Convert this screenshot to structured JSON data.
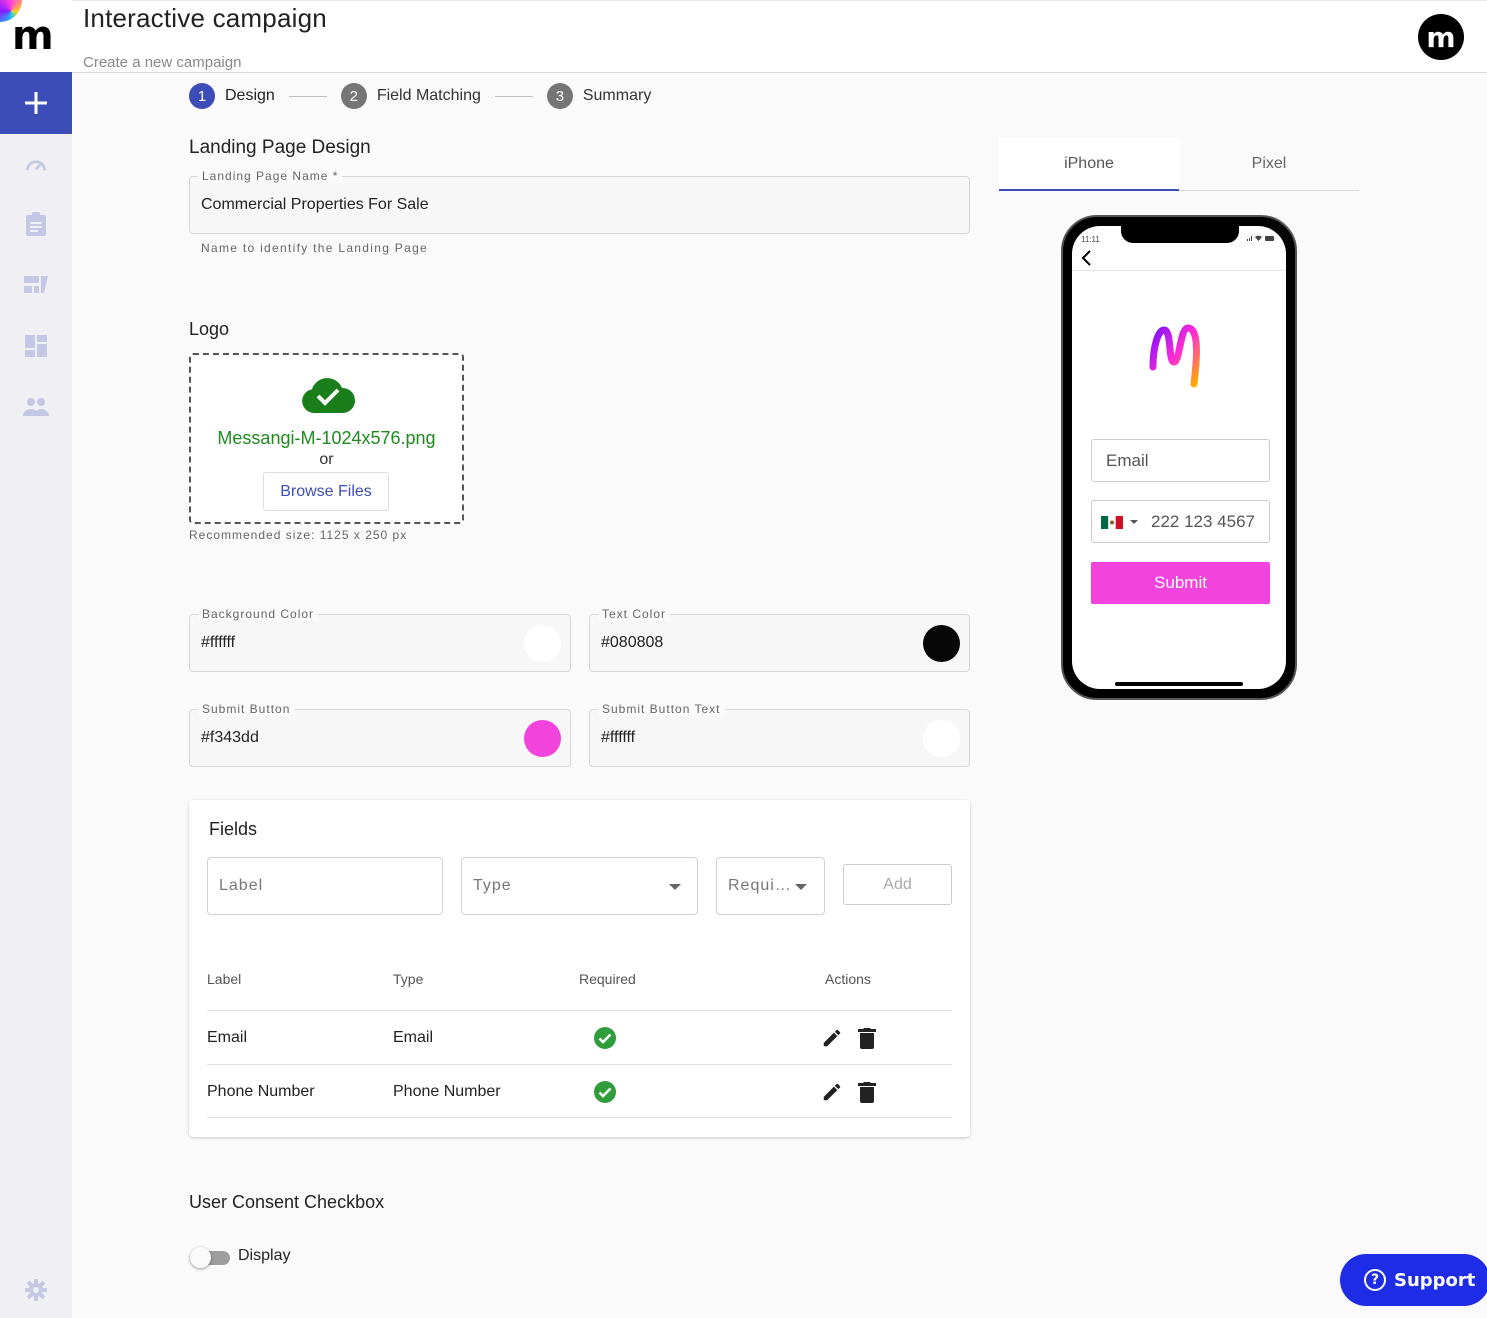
{
  "app": {
    "logo_letter": "m",
    "avatar_letter": "m"
  },
  "header": {
    "title": "Interactive campaign",
    "subtitle": "Create a new campaign"
  },
  "sidebar": {
    "items": [
      {
        "icon": "add-icon"
      },
      {
        "icon": "dashboard-gauge-icon"
      },
      {
        "icon": "clipboard-icon"
      },
      {
        "icon": "campaign-cards-icon"
      },
      {
        "icon": "grid-layout-icon"
      },
      {
        "icon": "people-icon"
      },
      {
        "icon": "gear-icon"
      }
    ]
  },
  "stepper": {
    "steps": [
      {
        "num": "1",
        "label": "Design",
        "active": true
      },
      {
        "num": "2",
        "label": "Field Matching"
      },
      {
        "num": "3",
        "label": "Summary"
      }
    ]
  },
  "landing": {
    "section_title": "Landing Page Design",
    "name_label": "Landing Page Name *",
    "name_value": "Commercial Properties For Sale",
    "name_helper": "Name to identify the Landing Page"
  },
  "logo": {
    "section_title": "Logo",
    "filename": "Messangi-M-1024x576.png",
    "or_text": "or",
    "browse_label": "Browse Files",
    "recommended": "Recommended size: 1125 x 250 px"
  },
  "colors": {
    "background": {
      "label": "Background Color",
      "value": "#ffffff"
    },
    "text": {
      "label": "Text Color",
      "value": "#080808"
    },
    "submit": {
      "label": "Submit Button",
      "value": "#f343dd"
    },
    "submit_text": {
      "label": "Submit Button Text",
      "value": "#ffffff"
    }
  },
  "fields": {
    "title": "Fields",
    "label_placeholder": "Label",
    "type_placeholder": "Type",
    "required_placeholder": "Requi…",
    "add_label": "Add",
    "columns": [
      "Label",
      "Type",
      "Required",
      "Actions"
    ],
    "rows": [
      {
        "label": "Email",
        "type": "Email",
        "required": true
      },
      {
        "label": "Phone Number",
        "type": "Phone Number",
        "required": true
      }
    ]
  },
  "consent": {
    "title": "User Consent Checkbox",
    "toggle_label": "Display",
    "enabled": false
  },
  "preview": {
    "tabs": [
      {
        "label": "iPhone",
        "active": true
      },
      {
        "label": "Pixel"
      }
    ],
    "time": "11:11",
    "email_placeholder": "Email",
    "phone_placeholder": "222 123 4567",
    "submit_label": "Submit"
  },
  "support": {
    "label": "Support"
  }
}
